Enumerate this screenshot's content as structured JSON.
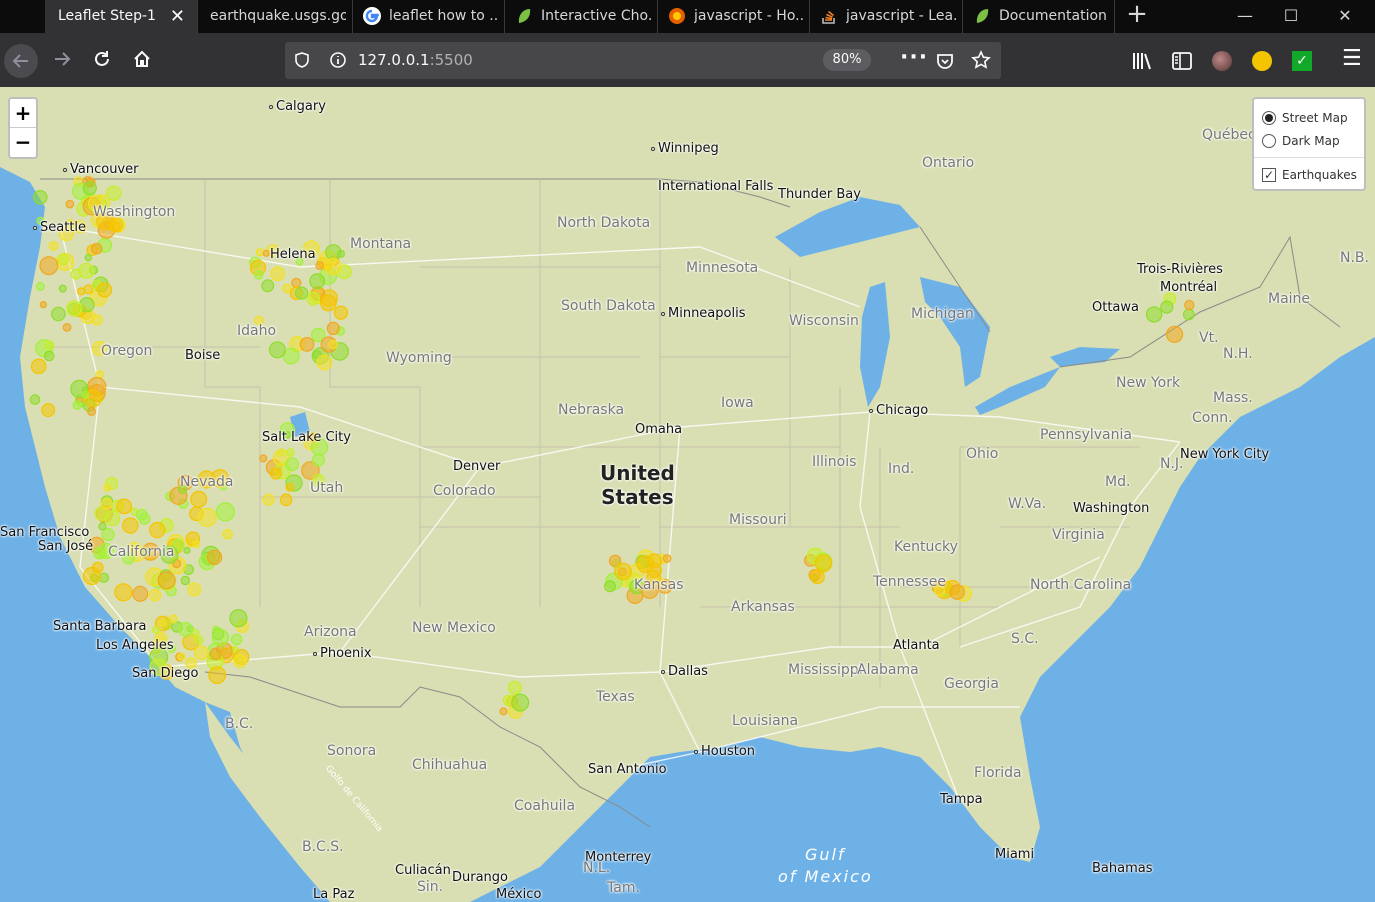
{
  "browser": {
    "tabs": [
      {
        "label": "Leaflet Step-1",
        "active": true,
        "icon": "none"
      },
      {
        "label": "earthquake.usgs.gov",
        "icon": "none"
      },
      {
        "label": "leaflet how to ...",
        "icon": "google-icon"
      },
      {
        "label": "Interactive Cho...",
        "icon": "leaf-icon"
      },
      {
        "label": "javascript - Ho...",
        "icon": "firefox-icon"
      },
      {
        "label": "javascript - Lea...",
        "icon": "stackoverflow-icon"
      },
      {
        "label": "Documentation",
        "icon": "leaf-icon"
      }
    ],
    "new_tab": "+",
    "url_host": "127.0.0.1",
    "url_port": ":5500",
    "zoom": "80%",
    "window_controls": [
      "minimize",
      "maximize",
      "close"
    ]
  },
  "map": {
    "zoom_in": "+",
    "zoom_out": "−",
    "layers": {
      "base": [
        {
          "label": "Street Map",
          "selected": true
        },
        {
          "label": "Dark Map",
          "selected": false
        }
      ],
      "overlays": [
        {
          "label": "Earthquakes",
          "checked": true
        }
      ]
    },
    "country_label": [
      "United",
      "States"
    ],
    "sea_label": [
      "Gulf",
      "of Mexico"
    ],
    "cities": [
      "Calgary",
      "Winnipeg",
      "Vancouver",
      "Seattle",
      "International Falls",
      "Thunder Bay",
      "Helena",
      "Minneapolis",
      "Trois-Rivières",
      "Montréal",
      "Ottawa",
      "Boise",
      "Chicago",
      "Omaha",
      "Salt Lake City",
      "Denver",
      "New York City",
      "Washington",
      "San Francisco",
      "San José",
      "Santa Barbara",
      "Los Angeles",
      "San Diego",
      "Phoenix",
      "Dallas",
      "Atlanta",
      "Houston",
      "San Antonio",
      "Tampa",
      "Miami",
      "Bahamas",
      "Monterrey",
      "Culiacán",
      "Durango",
      "La Paz",
      "México"
    ],
    "states": [
      "Washington",
      "Montana",
      "North Dakota",
      "Minnesota",
      "Ontario",
      "Québec",
      "Idaho",
      "Oregon",
      "Wyoming",
      "South Dakota",
      "Wisconsin",
      "Michigan",
      "Maine",
      "N.B.",
      "Nevada",
      "Utah",
      "Colorado",
      "Nebraska",
      "Iowa",
      "Illinois",
      "Ind.",
      "Ohio",
      "Pennsylvania",
      "New York",
      "Mass.",
      "Conn.",
      "N.J.",
      "Md.",
      "W.Va.",
      "Virginia",
      "California",
      "Arizona",
      "New Mexico",
      "Kansas",
      "Missouri",
      "Kentucky",
      "Tennessee",
      "North Carolina",
      "Arkansas",
      "Mississippi",
      "Alabama",
      "Georgia",
      "S.C.",
      "Texas",
      "Louisiana",
      "Florida",
      "Sonora",
      "Chihuahua",
      "Coahuila",
      "B.C.S.",
      "N.L.",
      "Sin.",
      "Tam.",
      "Vt.",
      "N.H.",
      "B.C.",
      "Golfo de California"
    ]
  }
}
